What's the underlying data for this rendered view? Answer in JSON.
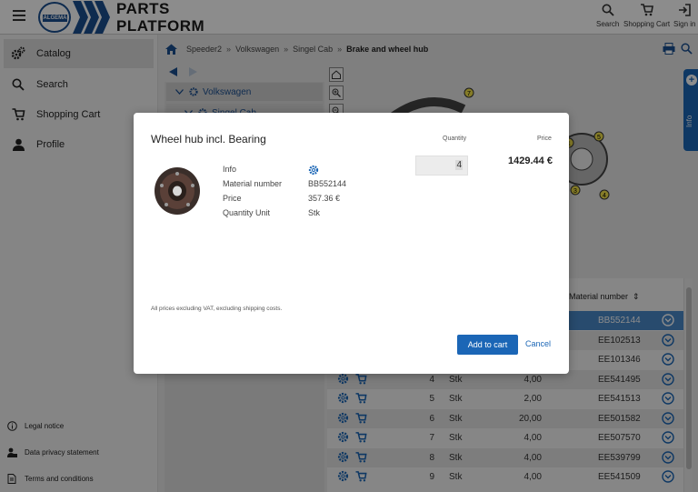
{
  "header": {
    "brand_small": "ALGEMA FIT-ZEL",
    "brand_line1": "PARTS",
    "brand_line2": "PLATFORM",
    "actions": [
      {
        "label": "Search",
        "icon": "search-icon"
      },
      {
        "label": "Shopping Cart",
        "icon": "cart-icon"
      },
      {
        "label": "Sign in",
        "icon": "sign-in-icon"
      }
    ]
  },
  "sidebar": {
    "items": [
      {
        "label": "Catalog",
        "icon": "gears-icon",
        "active": true
      },
      {
        "label": "Search",
        "icon": "search-icon"
      },
      {
        "label": "Shopping Cart",
        "icon": "cart-icon"
      },
      {
        "label": "Profile",
        "icon": "user-icon"
      }
    ],
    "footer": [
      {
        "label": "Legal notice",
        "icon": "info-icon"
      },
      {
        "label": "Data privacy statement",
        "icon": "user-lock-icon"
      },
      {
        "label": "Terms and conditions",
        "icon": "document-icon"
      }
    ]
  },
  "breadcrumb": {
    "items": [
      "Speeder2",
      "Volkswagen",
      "Singel Cab"
    ],
    "current": "Brake and wheel hub",
    "separator": "»"
  },
  "tree": {
    "items": [
      {
        "label": "Volkswagen"
      },
      {
        "label": "Singel Cab"
      }
    ]
  },
  "side_tab": {
    "label": "Info"
  },
  "table": {
    "header_material": "Material number",
    "rows": [
      {
        "pos": "",
        "unit": "",
        "qty": "",
        "material": "BB552144",
        "selected": true
      },
      {
        "pos": "",
        "unit": "",
        "qty": "",
        "material": "EE102513"
      },
      {
        "pos": "",
        "unit": "",
        "qty": "",
        "material": "EE101346"
      },
      {
        "pos": "4",
        "unit": "Stk",
        "qty": "4,00",
        "material": "EE541495"
      },
      {
        "pos": "5",
        "unit": "Stk",
        "qty": "2,00",
        "material": "EE541513"
      },
      {
        "pos": "6",
        "unit": "Stk",
        "qty": "20,00",
        "material": "EE501582"
      },
      {
        "pos": "7",
        "unit": "Stk",
        "qty": "4,00",
        "material": "EE507570"
      },
      {
        "pos": "8",
        "unit": "Stk",
        "qty": "4,00",
        "material": "EE539799"
      },
      {
        "pos": "9",
        "unit": "Stk",
        "qty": "4,00",
        "material": "EE541509"
      }
    ]
  },
  "callouts": [
    "7",
    "5",
    "4",
    "3",
    "1"
  ],
  "modal": {
    "title": "Wheel hub incl. Bearing",
    "quantity_label": "Quantity",
    "price_label": "Price",
    "quantity_value": "4",
    "total_price": "1429.44 €",
    "details": [
      {
        "key": "Info",
        "value": ""
      },
      {
        "key": "Material number",
        "value": "BB552144"
      },
      {
        "key": "Price",
        "value": "357.36 €"
      },
      {
        "key": "Quantity Unit",
        "value": "Stk"
      }
    ],
    "note": "All prices excluding VAT, excluding shipping costs.",
    "add_button": "Add to cart",
    "cancel_button": "Cancel"
  },
  "colors": {
    "accent": "#1b66b6",
    "brand": "#1b4f91",
    "selected_row": "#4a89c9"
  }
}
